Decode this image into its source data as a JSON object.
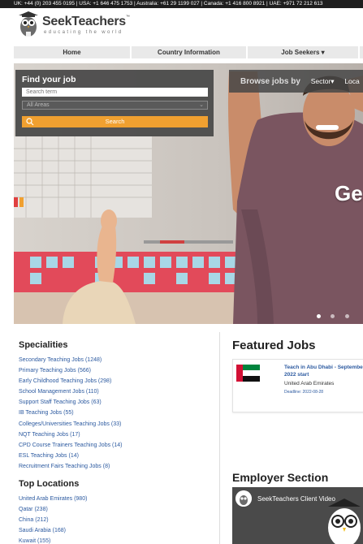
{
  "topbar": {
    "contacts": "UK: +44 (0) 203 455 0195  |  USA: +1 646 475 1753  |  Australia: +61 29 1199 027 |  Canada: +1 416 800 8921 |  UAE: +971 72 212 613"
  },
  "logo": {
    "name": "SeekTeachers",
    "tm": "™",
    "tagline": "educating the world"
  },
  "nav": {
    "items": [
      "Home",
      "Country Information",
      "Job Seekers ▾",
      ""
    ]
  },
  "search": {
    "title": "Find your job",
    "placeholder": "Search term",
    "area_value": "All Areas",
    "button": "Search"
  },
  "browse": {
    "label": "Browse jobs by",
    "options": [
      "Sector▾",
      "Loca"
    ]
  },
  "hero": {
    "word": "Ge"
  },
  "specialities": {
    "title": "Specialities",
    "items": [
      "Secondary Teaching Jobs (1248)",
      "Primary Teaching Jobs (566)",
      "Early Childhood Teaching Jobs (298)",
      "School Management Jobs (110)",
      "Support Staff Teaching Jobs (63)",
      "IB Teaching Jobs (55)",
      "Colleges/Universities Teaching Jobs (33)",
      "NQT Teaching Jobs (17)",
      "CPD Course Trainers Teaching Jobs (14)",
      "ESL Teaching Jobs (14)",
      "Recruitment Fairs Teaching Jobs (8)"
    ]
  },
  "locations": {
    "title": "Top Locations",
    "items": [
      "United Arab Emirates (980)",
      "Qatar (238)",
      "China (212)",
      "Saudi Arabia (168)",
      "Kuwait (155)"
    ]
  },
  "featured": {
    "title": "Featured Jobs",
    "job": {
      "title": "Teach in Abu Dhabi - September 2022 start",
      "location": "United Arab Emirates",
      "deadline": "Deadline: 2022-08-28"
    }
  },
  "employer": {
    "title": "Employer Section",
    "video_title": "SeekTeachers Client Video"
  },
  "colors": {
    "accent": "#f0a030",
    "link": "#2c5aa0",
    "topbar": "#1e1e1e"
  }
}
